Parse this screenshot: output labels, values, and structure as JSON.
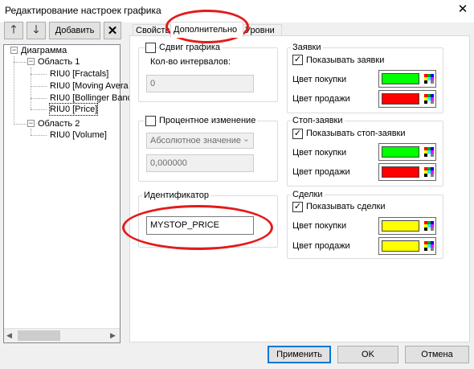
{
  "window": {
    "title": "Редактирование настроек графика",
    "close_glyph": "✕"
  },
  "toolbar": {
    "up_glyph": "🡑",
    "down_glyph": "🡓",
    "add_label": "Добавить",
    "delete_glyph": "✕"
  },
  "tree": {
    "root": "Диаграмма",
    "areas": [
      {
        "label": "Область 1",
        "children": [
          "RIU0 [Fractals]",
          "RIU0 [Moving Avera",
          "RIU0 [Bollinger Banc",
          "RIU0 [Price]"
        ]
      },
      {
        "label": "Область 2",
        "children": [
          "RIU0 [Volume]"
        ]
      }
    ],
    "minus": "−"
  },
  "tabs": [
    "Свойства",
    "Дополнительно",
    "Уровни"
  ],
  "left": {
    "shift_label": "Сдвиг графика",
    "intervals_label": "Кол-во интервалов:",
    "intervals_value": "0",
    "percent_label": "Процентное изменение",
    "abs_select": "Абсолютное значение",
    "percent_value": "0,000000",
    "ident_label": "Идентификатор",
    "ident_value": "MYSTOP_PRICE"
  },
  "groups": {
    "orders": {
      "title": "Заявки",
      "check_label": "Показывать заявки",
      "buy_label": "Цвет покупки",
      "sell_label": "Цвет продажи",
      "buy_color": "#00ff00",
      "sell_color": "#ff0000"
    },
    "stops": {
      "title": "Стоп-заявки",
      "check_label": "Показывать стоп-заявки",
      "buy_label": "Цвет покупки",
      "sell_label": "Цвет продажи",
      "buy_color": "#00ff00",
      "sell_color": "#ff0000"
    },
    "deals": {
      "title": "Сделки",
      "check_label": "Показывать сделки",
      "buy_label": "Цвет покупки",
      "sell_label": "Цвет продажи",
      "buy_color": "#ffff00",
      "sell_color": "#ffff00"
    }
  },
  "checkmark": "✓",
  "dropdown_glyph": "⌄",
  "scroll_left": "◀",
  "scroll_right": "▶",
  "buttons": {
    "apply": "Применить",
    "ok": "OK",
    "cancel": "Отмена"
  },
  "palette_colors": [
    "#ff0000",
    "#00aa00",
    "#0000ff",
    "#ffff00",
    "#00ffff",
    "#ff00ff",
    "#000000",
    "#ffffff",
    "#808080"
  ]
}
